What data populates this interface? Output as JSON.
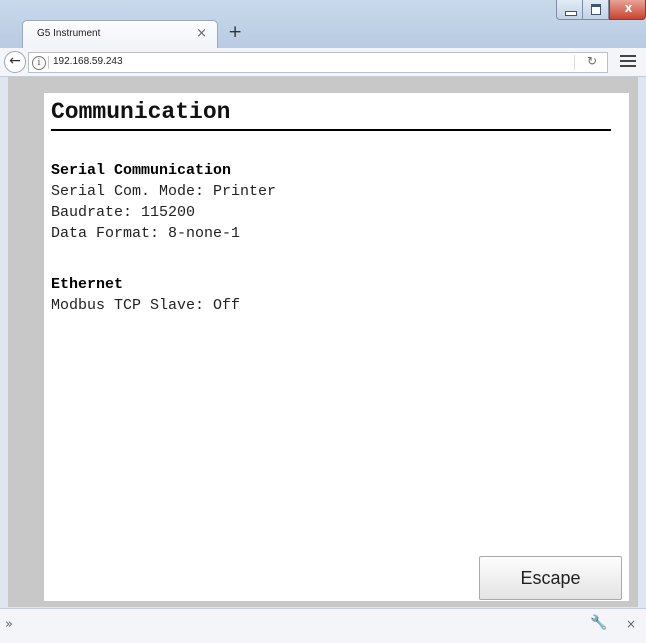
{
  "browser": {
    "tab_title": "G5 Instrument",
    "tab_close": "×",
    "new_tab": "+",
    "url": "192.168.59.243",
    "back_icon": "arrow-left-icon",
    "info_icon": "i",
    "reload_icon": "C",
    "window_close": "x"
  },
  "page": {
    "heading": "Communication",
    "sections": [
      {
        "title": "Serial Communication",
        "lines": [
          "Serial Com. Mode: Printer",
          "Baudrate: 115200",
          "Data Format: 8-none-1"
        ]
      },
      {
        "title": "Ethernet",
        "lines": [
          "Modbus TCP Slave: Off"
        ]
      }
    ],
    "escape_label": "Escape"
  },
  "bottom_bar": {
    "chevron": "»",
    "wrench": "🔧",
    "close": "×"
  }
}
